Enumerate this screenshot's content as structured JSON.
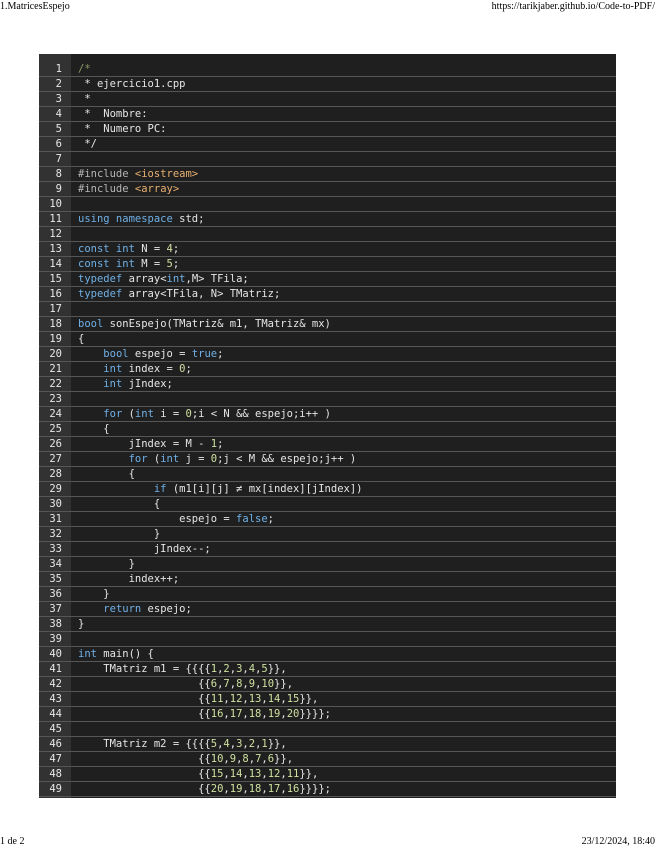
{
  "header": {
    "title": "1.MatricesEspejo",
    "url": "https://tarikjaber.github.io/Code-to-PDF/"
  },
  "footer": {
    "page": "1 de 2",
    "timestamp": "23/12/2024, 18:40"
  },
  "code": {
    "lines": [
      {
        "n": "1",
        "t": [
          [
            "cm",
            "/*"
          ]
        ]
      },
      {
        "n": "2",
        "t": [
          [
            "id",
            " * ejercicio1.cpp"
          ]
        ]
      },
      {
        "n": "3",
        "t": [
          [
            "id",
            " *"
          ]
        ]
      },
      {
        "n": "4",
        "t": [
          [
            "id",
            " *  Nombre:"
          ]
        ]
      },
      {
        "n": "5",
        "t": [
          [
            "id",
            " *  Numero PC:"
          ]
        ]
      },
      {
        "n": "6",
        "t": [
          [
            "id",
            " */"
          ]
        ]
      },
      {
        "n": "7",
        "t": []
      },
      {
        "n": "8",
        "t": [
          [
            "pp",
            "#include "
          ],
          [
            "str",
            "<iostream>"
          ]
        ]
      },
      {
        "n": "9",
        "t": [
          [
            "pp",
            "#include "
          ],
          [
            "str",
            "<array>"
          ]
        ]
      },
      {
        "n": "10",
        "t": []
      },
      {
        "n": "11",
        "t": [
          [
            "kw",
            "using namespace"
          ],
          [
            "id",
            " std;"
          ]
        ]
      },
      {
        "n": "12",
        "t": []
      },
      {
        "n": "13",
        "t": [
          [
            "kw",
            "const int"
          ],
          [
            "id",
            " N = "
          ],
          [
            "num",
            "4"
          ],
          [
            "id",
            ";"
          ]
        ]
      },
      {
        "n": "14",
        "t": [
          [
            "kw",
            "const int"
          ],
          [
            "id",
            " M = "
          ],
          [
            "num",
            "5"
          ],
          [
            "id",
            ";"
          ]
        ]
      },
      {
        "n": "15",
        "t": [
          [
            "kw",
            "typedef"
          ],
          [
            "id",
            " array<"
          ],
          [
            "kw",
            "int"
          ],
          [
            "id",
            ",M> TFila;"
          ]
        ]
      },
      {
        "n": "16",
        "t": [
          [
            "kw",
            "typedef"
          ],
          [
            "id",
            " array<TFila, N> TMatriz;"
          ]
        ]
      },
      {
        "n": "17",
        "t": []
      },
      {
        "n": "18",
        "t": [
          [
            "kw",
            "bool"
          ],
          [
            "id",
            " sonEspejo(TMatriz& m1, TMatriz& mx)"
          ]
        ]
      },
      {
        "n": "19",
        "t": [
          [
            "id",
            "{"
          ]
        ]
      },
      {
        "n": "20",
        "t": [
          [
            "id",
            "    "
          ],
          [
            "kw",
            "bool"
          ],
          [
            "id",
            " espejo = "
          ],
          [
            "kw",
            "true"
          ],
          [
            "id",
            ";"
          ]
        ]
      },
      {
        "n": "21",
        "t": [
          [
            "id",
            "    "
          ],
          [
            "kw",
            "int"
          ],
          [
            "id",
            " index = "
          ],
          [
            "num",
            "0"
          ],
          [
            "id",
            ";"
          ]
        ]
      },
      {
        "n": "22",
        "t": [
          [
            "id",
            "    "
          ],
          [
            "kw",
            "int"
          ],
          [
            "id",
            " jIndex;"
          ]
        ]
      },
      {
        "n": "23",
        "t": []
      },
      {
        "n": "24",
        "t": [
          [
            "id",
            "    "
          ],
          [
            "kw",
            "for"
          ],
          [
            "id",
            " ("
          ],
          [
            "kw",
            "int"
          ],
          [
            "id",
            " i = "
          ],
          [
            "num",
            "0"
          ],
          [
            "id",
            ";i < N && espejo;i++ )"
          ]
        ]
      },
      {
        "n": "25",
        "t": [
          [
            "id",
            "    {"
          ]
        ]
      },
      {
        "n": "26",
        "t": [
          [
            "id",
            "        jIndex = M - "
          ],
          [
            "num",
            "1"
          ],
          [
            "id",
            ";"
          ]
        ]
      },
      {
        "n": "27",
        "t": [
          [
            "id",
            "        "
          ],
          [
            "kw",
            "for"
          ],
          [
            "id",
            " ("
          ],
          [
            "kw",
            "int"
          ],
          [
            "id",
            " j = "
          ],
          [
            "num",
            "0"
          ],
          [
            "id",
            ";j < M && espejo;j++ )"
          ]
        ]
      },
      {
        "n": "28",
        "t": [
          [
            "id",
            "        {"
          ]
        ]
      },
      {
        "n": "29",
        "t": [
          [
            "id",
            "            "
          ],
          [
            "kw",
            "if"
          ],
          [
            "id",
            " (m1[i][j] ≠ mx[index][jIndex])"
          ]
        ]
      },
      {
        "n": "30",
        "t": [
          [
            "id",
            "            {"
          ]
        ]
      },
      {
        "n": "31",
        "t": [
          [
            "id",
            "                espejo = "
          ],
          [
            "kw",
            "false"
          ],
          [
            "id",
            ";"
          ]
        ]
      },
      {
        "n": "32",
        "t": [
          [
            "id",
            "            }"
          ]
        ]
      },
      {
        "n": "33",
        "t": [
          [
            "id",
            "            jIndex--;"
          ]
        ]
      },
      {
        "n": "34",
        "t": [
          [
            "id",
            "        }"
          ]
        ]
      },
      {
        "n": "35",
        "t": [
          [
            "id",
            "        index++;"
          ]
        ]
      },
      {
        "n": "36",
        "t": [
          [
            "id",
            "    }"
          ]
        ]
      },
      {
        "n": "37",
        "t": [
          [
            "id",
            "    "
          ],
          [
            "kw",
            "return"
          ],
          [
            "id",
            " espejo;"
          ]
        ]
      },
      {
        "n": "38",
        "t": [
          [
            "id",
            "}"
          ]
        ]
      },
      {
        "n": "39",
        "t": []
      },
      {
        "n": "40",
        "t": [
          [
            "kw",
            "int"
          ],
          [
            "id",
            " main() {"
          ]
        ]
      },
      {
        "n": "41",
        "t": [
          [
            "id",
            "    TMatriz m1 = {{{{"
          ],
          [
            "num",
            "1"
          ],
          [
            "id",
            ","
          ],
          [
            "num",
            "2"
          ],
          [
            "id",
            ","
          ],
          [
            "num",
            "3"
          ],
          [
            "id",
            ","
          ],
          [
            "num",
            "4"
          ],
          [
            "id",
            ","
          ],
          [
            "num",
            "5"
          ],
          [
            "id",
            "}},"
          ]
        ]
      },
      {
        "n": "42",
        "t": [
          [
            "id",
            "                   {{"
          ],
          [
            "num",
            "6"
          ],
          [
            "id",
            ","
          ],
          [
            "num",
            "7"
          ],
          [
            "id",
            ","
          ],
          [
            "num",
            "8"
          ],
          [
            "id",
            ","
          ],
          [
            "num",
            "9"
          ],
          [
            "id",
            ","
          ],
          [
            "num",
            "10"
          ],
          [
            "id",
            "}},"
          ]
        ]
      },
      {
        "n": "43",
        "t": [
          [
            "id",
            "                   {{"
          ],
          [
            "num",
            "11"
          ],
          [
            "id",
            ","
          ],
          [
            "num",
            "12"
          ],
          [
            "id",
            ","
          ],
          [
            "num",
            "13"
          ],
          [
            "id",
            ","
          ],
          [
            "num",
            "14"
          ],
          [
            "id",
            ","
          ],
          [
            "num",
            "15"
          ],
          [
            "id",
            "}},"
          ]
        ]
      },
      {
        "n": "44",
        "t": [
          [
            "id",
            "                   {{"
          ],
          [
            "num",
            "16"
          ],
          [
            "id",
            ","
          ],
          [
            "num",
            "17"
          ],
          [
            "id",
            ","
          ],
          [
            "num",
            "18"
          ],
          [
            "id",
            ","
          ],
          [
            "num",
            "19"
          ],
          [
            "id",
            ","
          ],
          [
            "num",
            "20"
          ],
          [
            "id",
            "}}}};"
          ]
        ]
      },
      {
        "n": "45",
        "t": []
      },
      {
        "n": "46",
        "t": [
          [
            "id",
            "    TMatriz m2 = {{{{"
          ],
          [
            "num",
            "5"
          ],
          [
            "id",
            ","
          ],
          [
            "num",
            "4"
          ],
          [
            "id",
            ","
          ],
          [
            "num",
            "3"
          ],
          [
            "id",
            ","
          ],
          [
            "num",
            "2"
          ],
          [
            "id",
            ","
          ],
          [
            "num",
            "1"
          ],
          [
            "id",
            "}},"
          ]
        ]
      },
      {
        "n": "47",
        "t": [
          [
            "id",
            "                   {{"
          ],
          [
            "num",
            "10"
          ],
          [
            "id",
            ","
          ],
          [
            "num",
            "9"
          ],
          [
            "id",
            ","
          ],
          [
            "num",
            "8"
          ],
          [
            "id",
            ","
          ],
          [
            "num",
            "7"
          ],
          [
            "id",
            ","
          ],
          [
            "num",
            "6"
          ],
          [
            "id",
            "}},"
          ]
        ]
      },
      {
        "n": "48",
        "t": [
          [
            "id",
            "                   {{"
          ],
          [
            "num",
            "15"
          ],
          [
            "id",
            ","
          ],
          [
            "num",
            "14"
          ],
          [
            "id",
            ","
          ],
          [
            "num",
            "13"
          ],
          [
            "id",
            ","
          ],
          [
            "num",
            "12"
          ],
          [
            "id",
            ","
          ],
          [
            "num",
            "11"
          ],
          [
            "id",
            "}},"
          ]
        ]
      },
      {
        "n": "49",
        "t": [
          [
            "id",
            "                   {{"
          ],
          [
            "num",
            "20"
          ],
          [
            "id",
            ","
          ],
          [
            "num",
            "19"
          ],
          [
            "id",
            ","
          ],
          [
            "num",
            "18"
          ],
          [
            "id",
            ","
          ],
          [
            "num",
            "17"
          ],
          [
            "id",
            ","
          ],
          [
            "num",
            "16"
          ],
          [
            "id",
            "}}}};"
          ]
        ]
      }
    ]
  }
}
